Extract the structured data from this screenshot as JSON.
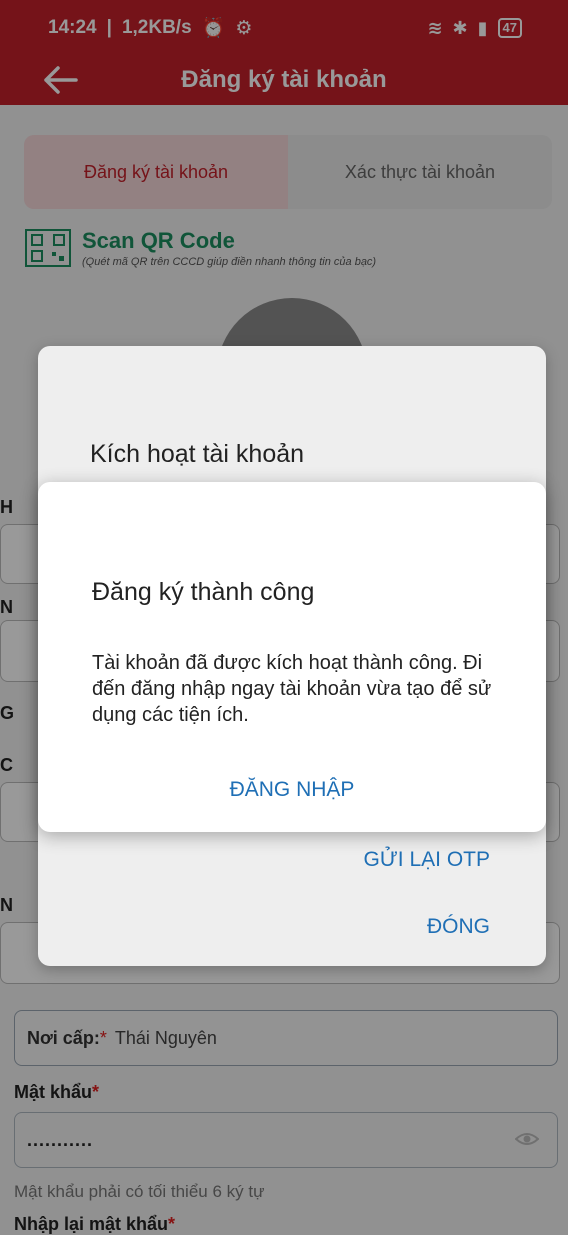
{
  "status_bar": {
    "time": "14:24",
    "net_speed": "1,2KB/s",
    "battery": "47"
  },
  "header": {
    "title": "Đăng ký tài khoản"
  },
  "tabs": [
    {
      "label": "Đăng ký tài khoản"
    },
    {
      "label": "Xác thực tài khoản"
    }
  ],
  "qr": {
    "title": "Scan QR Code",
    "subtitle": "(Quét mã QR trên CCCD giúp điền nhanh thông tin của bạc)"
  },
  "form": {
    "issue_place": {
      "label": "Nơi cấp:",
      "value": "Thái Nguyên"
    },
    "password": {
      "label": "Mật khẩu",
      "value": "...........",
      "hint": "Mật khẩu phải có tối thiểu 6 ký tự"
    },
    "confirm_password": {
      "label": "Nhập lại mật khẩu"
    }
  },
  "dialog_activate": {
    "title": "Kích hoạt tài khoản",
    "resend": "GỬI LẠI OTP",
    "close": "ĐÓNG"
  },
  "dialog_success": {
    "title": "Đăng ký thành công",
    "message": "Tài khoản đã được kích hoạt thành công. Đi đến đăng nhập ngay tài khoản vừa tạo để sử dụng các tiện ích.",
    "action": "ĐĂNG NHẬP"
  },
  "colors": {
    "brand": "#c4202b",
    "link": "#1f6fb5",
    "qr": "#1b8e5f"
  }
}
